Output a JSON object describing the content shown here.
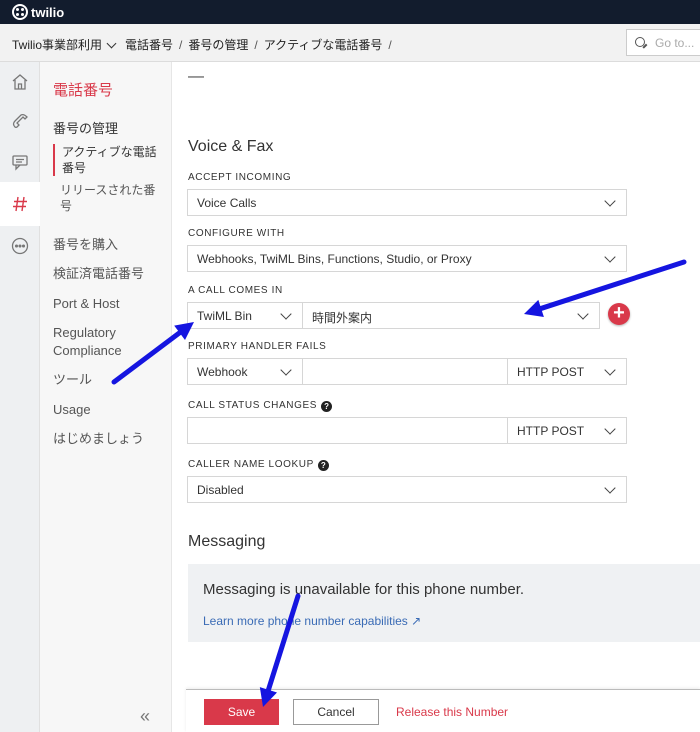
{
  "brand": {
    "name": "twilio",
    "colors": {
      "topbar": "#121c2d",
      "accent": "#d9394a",
      "link": "#3a6bb5",
      "annotation_arrow": "#1515e0"
    }
  },
  "breadcrumb": {
    "account": "Twilio事業部利用",
    "items": [
      "電話番号",
      "番号の管理",
      "アクティブな電話番号"
    ],
    "separator": "/"
  },
  "search": {
    "placeholder": "Go to..."
  },
  "rail": {
    "icons": [
      "home-icon",
      "phone-icon",
      "chat-icon",
      "hash-icon",
      "more-icon"
    ],
    "active": "hash-icon"
  },
  "subnav": {
    "title": "電話番号",
    "section": "番号の管理",
    "sub_items": [
      "アクティブな電話番号",
      "リリースされた番号"
    ],
    "items": [
      "番号を購入",
      "検証済電話番号",
      "Port & Host",
      "Regulatory Compliance",
      "ツール",
      "Usage",
      "はじめましょう"
    ],
    "collapse": "«"
  },
  "form": {
    "notes_value": "—",
    "voice_title": "Voice & Fax",
    "accept_incoming": {
      "label": "ACCEPT INCOMING",
      "value": "Voice Calls"
    },
    "configure_with": {
      "label": "CONFIGURE WITH",
      "value": "Webhooks, TwiML Bins, Functions, Studio, or Proxy"
    },
    "call_comes_in": {
      "label": "A CALL COMES IN",
      "type": "TwiML Bin",
      "value": "時間外案内"
    },
    "primary_handler": {
      "label": "PRIMARY HANDLER FAILS",
      "type": "Webhook",
      "url": "",
      "method": "HTTP POST"
    },
    "call_status": {
      "label": "CALL STATUS CHANGES",
      "url": "",
      "method": "HTTP POST"
    },
    "caller_name": {
      "label": "CALLER NAME LOOKUP",
      "value": "Disabled"
    },
    "help_glyph": "?"
  },
  "messaging": {
    "title": "Messaging",
    "unavailable": "Messaging is unavailable for this phone number.",
    "learn_more": "Learn more phone number capabilities ↗"
  },
  "footer": {
    "save": "Save",
    "cancel": "Cancel",
    "release": "Release this Number"
  }
}
